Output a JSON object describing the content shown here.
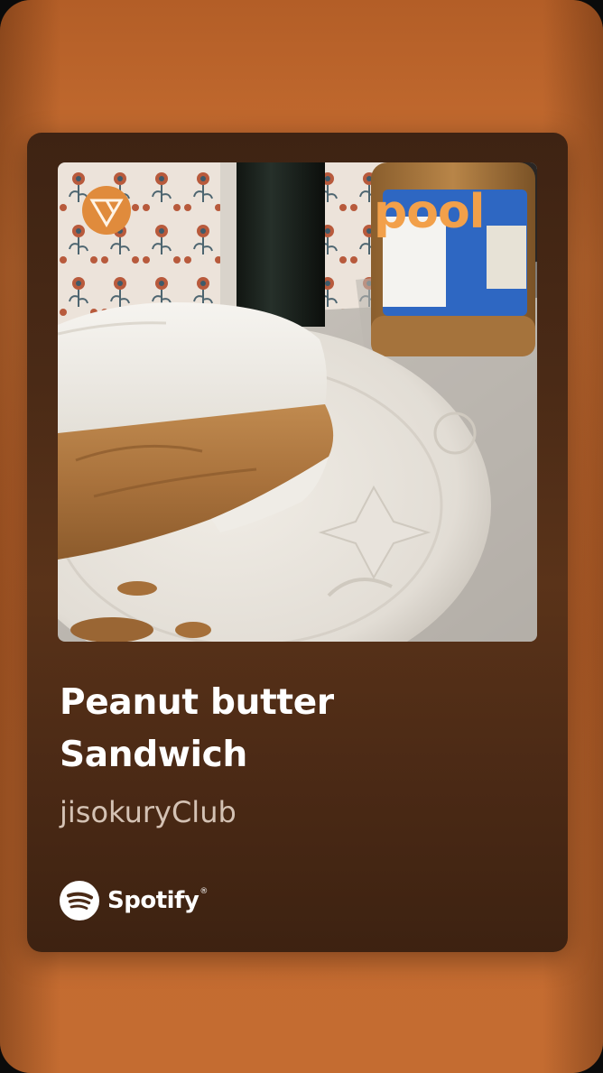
{
  "track": {
    "title": "Peanut butter Sandwich",
    "artist": "jisokuryClub"
  },
  "cover": {
    "logo_text": "pool",
    "logo_color": "#f2a04a",
    "badge_icon": "triangle-logo-icon"
  },
  "brand": {
    "name": "Spotify",
    "icon": "spotify-icon"
  },
  "colors": {
    "background_orange": "#c8692d",
    "card_brown": "#4a2a16",
    "text_primary": "#ffffff",
    "text_secondary": "#d4c2b4"
  }
}
